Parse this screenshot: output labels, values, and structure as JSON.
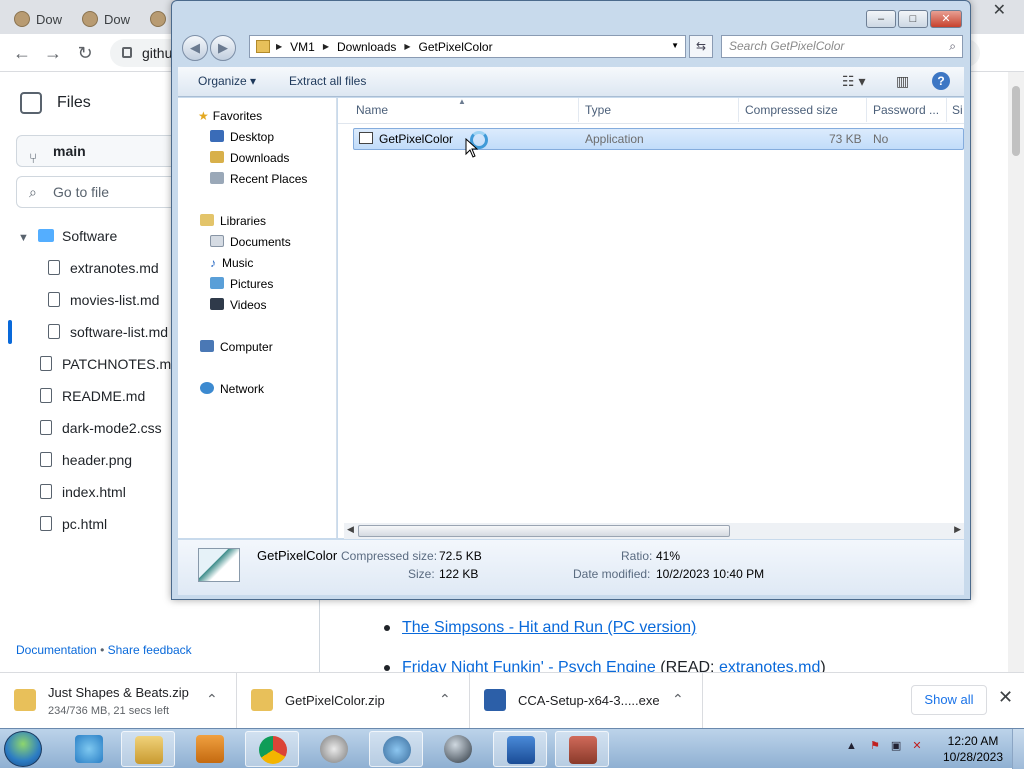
{
  "browser": {
    "tabs": [
      {
        "label": "Dow"
      },
      {
        "label": "Dow"
      },
      {
        "label": ""
      }
    ],
    "url_partial": "githu",
    "close_glyph": "✕"
  },
  "github": {
    "files_title": "Files",
    "branch": "main",
    "goto_placeholder": "Go to file",
    "tree": [
      {
        "label": "Software",
        "type": "folder"
      },
      {
        "label": "extranotes.md",
        "type": "file"
      },
      {
        "label": "movies-list.md",
        "type": "file"
      },
      {
        "label": "software-list.md",
        "type": "file",
        "active": true
      },
      {
        "label": "PATCHNOTES.md",
        "type": "file"
      },
      {
        "label": "README.md",
        "type": "file"
      },
      {
        "label": "dark-mode2.css",
        "type": "file"
      },
      {
        "label": "header.png",
        "type": "file"
      },
      {
        "label": "index.html",
        "type": "file"
      },
      {
        "label": "pc.html",
        "type": "file"
      }
    ],
    "footer": {
      "documentation": "Documentation",
      "separator": "•",
      "feedback": "Share feedback"
    },
    "content": {
      "link1": "The Simpsons - Hit and Run (PC version)",
      "link2_prefix": "Friday Night Funkin' - Psych Engine",
      "link2_mid": " (READ: ",
      "link2_link": "extranotes.md",
      "link2_suffix": ")"
    }
  },
  "downloads": {
    "items": [
      {
        "name": "Just Shapes & Beats.zip",
        "sub": "234/736 MB, 21 secs left"
      },
      {
        "name": "GetPixelColor.zip",
        "sub": ""
      },
      {
        "name": "CCA-Setup-x64-3.....exe",
        "sub": ""
      }
    ],
    "show_all": "Show all"
  },
  "explorer": {
    "breadcrumb": [
      "VM1",
      "Downloads",
      "GetPixelColor"
    ],
    "search_placeholder": "Search GetPixelColor",
    "commands": {
      "organize": "Organize",
      "extract": "Extract all files"
    },
    "nav": {
      "favorites": "Favorites",
      "favorite_items": [
        "Desktop",
        "Downloads",
        "Recent Places"
      ],
      "libraries": "Libraries",
      "library_items": [
        "Documents",
        "Music",
        "Pictures",
        "Videos"
      ],
      "computer": "Computer",
      "network": "Network"
    },
    "columns": [
      "Name",
      "Type",
      "Compressed size",
      "Password ...",
      "Si"
    ],
    "rows": [
      {
        "name": "GetPixelColor",
        "type": "Application",
        "compressed": "73 KB",
        "password": "No"
      }
    ],
    "details": {
      "name": "GetPixelColor",
      "compressed_label": "Compressed size:",
      "compressed_value": "72.5 KB",
      "size_label": "Size:",
      "size_value": "122 KB",
      "ratio_label": "Ratio:",
      "ratio_value": "41%",
      "modified_label": "Date modified:",
      "modified_value": "10/2/2023 10:40 PM"
    }
  },
  "taskbar": {
    "time": "12:20 AM",
    "date": "10/28/2023"
  },
  "colors": {
    "github_link": "#0969da",
    "explorer_selection": "#c1dcfa",
    "taskbar": "#9fbbd9"
  }
}
